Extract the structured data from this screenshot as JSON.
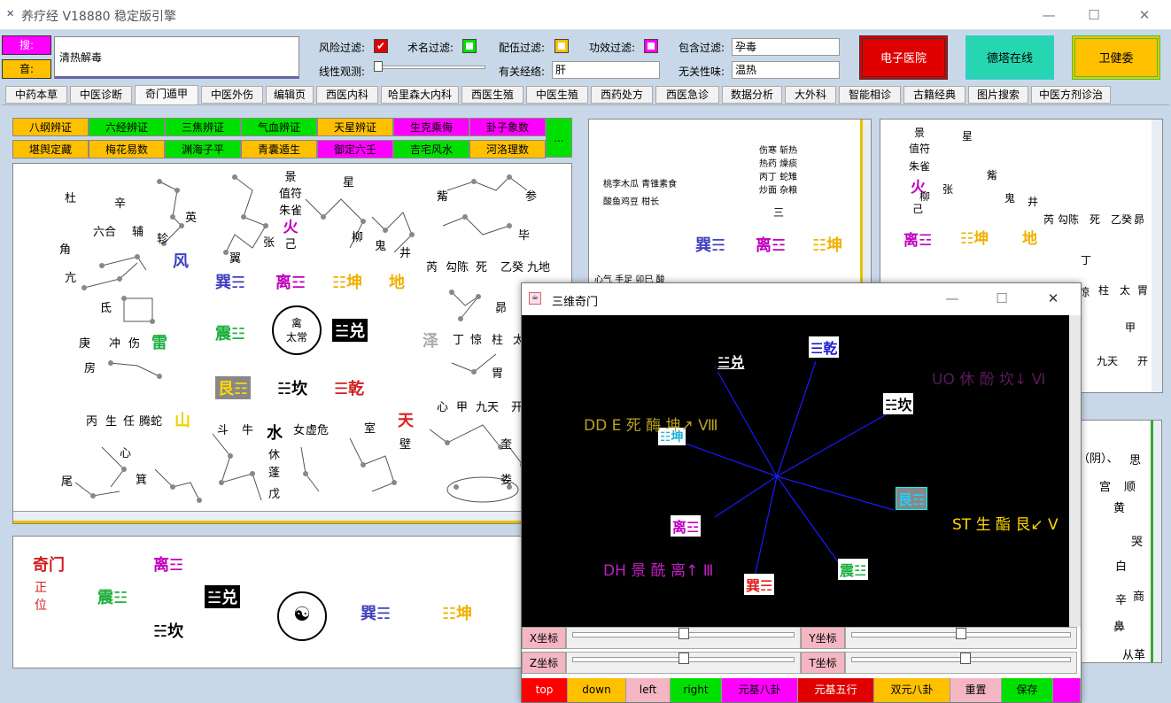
{
  "window": {
    "title": "养疗经 V18880 稳定版引擎",
    "min": "—",
    "max": "☐",
    "close": "✕"
  },
  "header": {
    "label1": "搜:",
    "label2": "音:",
    "search_text": "清热解毒",
    "filters": {
      "risk": "风险过滤:",
      "risk_checked": true,
      "surname": "术名过滤:",
      "pair": "配伍过滤:",
      "effect": "功效过滤:",
      "contain": "包含过滤:",
      "contain_value": "孕毒",
      "linear": "线性观测:",
      "related_meridian": "有关经络:",
      "related_meridian_value": "肝",
      "unrelated": "无关性味:",
      "unrelated_value": "温热"
    },
    "buttons": {
      "hospital": "电子医院",
      "online": "德塔在线",
      "health": "卫健委"
    }
  },
  "tabs": [
    "中药本草",
    "中医诊断",
    "奇门遁甲",
    "中医外伤",
    "编辑页",
    "西医内科",
    "哈里森大内科",
    "西医生殖",
    "中医生殖",
    "西药处方",
    "西医急诊",
    "数据分析",
    "大外科",
    "智能相诊",
    "古籍经典",
    "图片搜索",
    "中医方剂诊治"
  ],
  "active_tab": "奇门遁甲",
  "method_buttons": {
    "row1": [
      "八纲辨证",
      "六经辨证",
      "三焦辨证",
      "气血辨证",
      "天星辨证",
      "生克乘侮",
      "卦子象数"
    ],
    "row2": [
      "堪舆定藏",
      "梅花易数",
      "渊海子平",
      "青囊遁生",
      "御定六壬",
      "吉宅风水",
      "河洛理数"
    ],
    "more": "..."
  },
  "main_panel": {
    "stars": [
      "杜",
      "辛",
      "英",
      "六合",
      "辅",
      "轸",
      "角",
      "风",
      "亢",
      "氐",
      "庚",
      "冲",
      "伤",
      "雷",
      "房",
      "丙",
      "生",
      "任",
      "腾蛇",
      "山",
      "心",
      "箕",
      "尾",
      "斗",
      "牛",
      "水",
      "女",
      "虚危",
      "室",
      "天",
      "壁",
      "翼",
      "张",
      "柳",
      "鬼",
      "井",
      "觜",
      "参",
      "毕",
      "芮",
      "勾陈",
      "死",
      "乙癸",
      "九地",
      "泽",
      "丁",
      "惊",
      "柱",
      "太",
      "昴",
      "胃",
      "心",
      "甲",
      "九天",
      "开",
      "奎",
      "娄",
      "星",
      "休",
      "蓬",
      "戊"
    ],
    "jing_block": [
      "景",
      "值符",
      "朱雀",
      "火",
      "己"
    ],
    "center": [
      "禽",
      "太常"
    ],
    "gua": {
      "xun": "巽☴",
      "li": "离☲",
      "kun": "☷坤",
      "di": "地",
      "zhen": "震☳",
      "dui": "☱兑",
      "gen": "艮☶",
      "kan": "☵坎",
      "qian": "☰乾"
    }
  },
  "bottom_panel": {
    "title": "奇门",
    "pos": "正\n位",
    "li": "离☲",
    "zhen": "震☳",
    "dui": "☱兑",
    "kan": "☵坎",
    "xun": "巽☴",
    "kun": "☷坤"
  },
  "right_panel": {
    "lines": [
      "伤寒 斩热",
      "热药 燥痰",
      "丙丁 蛇雉",
      "炒面 杂粮"
    ],
    "left_lines": [
      "桃李木瓜 青锥素食",
      "酸鱼鸡豆 柑长"
    ],
    "san": "三",
    "xin": "心气 手足 卯巳 酸",
    "gua": [
      "巽☴",
      "离☲",
      "☷坤"
    ]
  },
  "far_right": {
    "items": [
      "景",
      "值符",
      "朱雀",
      "火",
      "己",
      "星",
      "柳",
      "张",
      "井",
      "觜",
      "鬼",
      "离☲",
      "☷坤",
      "地",
      "芮",
      "勾陈",
      "死",
      "乙癸",
      "昴",
      "丁",
      "惊",
      "柱",
      "太",
      "胃",
      "甲",
      "九天",
      "开"
    ],
    "side": [
      "（阴）、",
      "思",
      "宫",
      "顺",
      "黄",
      "哭",
      "白",
      "辛",
      "商",
      "鼻",
      "从革"
    ]
  },
  "win3d": {
    "title": "三维奇门",
    "min": "—",
    "max": "☐",
    "close": "✕",
    "nodes": {
      "dui": "☱兑",
      "qian": "☰乾",
      "kan": "☵坎",
      "kun": "☷坤",
      "gen": "艮☶",
      "li": "离☲",
      "xun": "巽☴",
      "zhen": "震☳"
    },
    "labels": {
      "uo": "UO 休 酚 坎↓ Ⅵ",
      "dd": "DD E 死 酶 坤↗ Ⅷ",
      "st": "ST 生 酯 艮↙ Ⅴ",
      "dh": "DH 景 酰 离↑ Ⅲ"
    },
    "sliders": {
      "x": "X坐标",
      "y": "Y坐标",
      "z": "Z坐标",
      "t": "T坐标",
      "x_val": 0.5,
      "y_val": 0.5,
      "z_val": 0.5,
      "t_val": 0.52
    },
    "buttons": [
      "top",
      "down",
      "left",
      "right",
      "元基八卦",
      "元基五行",
      "双元八卦",
      "重置",
      "保存"
    ]
  },
  "colors": {
    "accent_red": "#e00000",
    "magenta": "#ff00ff",
    "green": "#00e000",
    "yellow": "#ffc000"
  }
}
